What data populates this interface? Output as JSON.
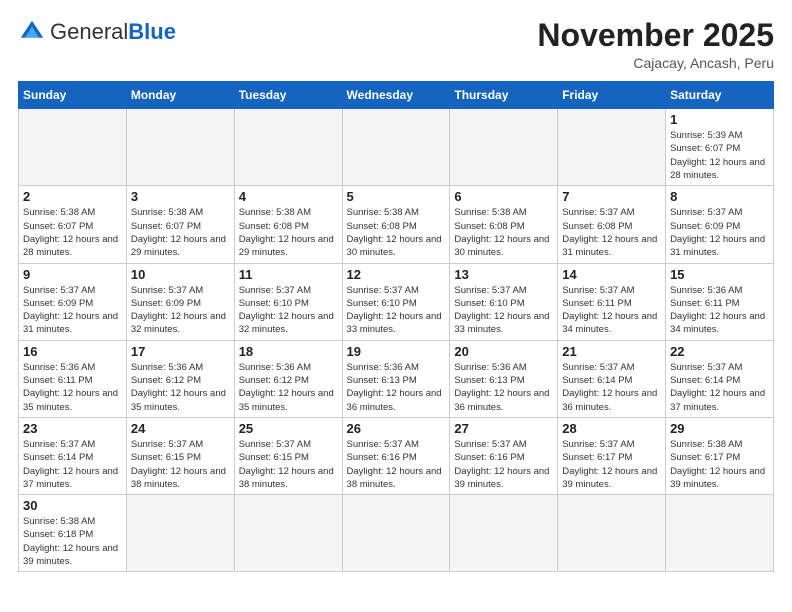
{
  "header": {
    "logo_general": "General",
    "logo_blue": "Blue",
    "month_year": "November 2025",
    "location": "Cajacay, Ancash, Peru"
  },
  "days_of_week": [
    "Sunday",
    "Monday",
    "Tuesday",
    "Wednesday",
    "Thursday",
    "Friday",
    "Saturday"
  ],
  "weeks": [
    [
      {
        "day": "",
        "info": ""
      },
      {
        "day": "",
        "info": ""
      },
      {
        "day": "",
        "info": ""
      },
      {
        "day": "",
        "info": ""
      },
      {
        "day": "",
        "info": ""
      },
      {
        "day": "",
        "info": ""
      },
      {
        "day": "1",
        "info": "Sunrise: 5:39 AM\nSunset: 6:07 PM\nDaylight: 12 hours and 28 minutes."
      }
    ],
    [
      {
        "day": "2",
        "info": "Sunrise: 5:38 AM\nSunset: 6:07 PM\nDaylight: 12 hours and 28 minutes."
      },
      {
        "day": "3",
        "info": "Sunrise: 5:38 AM\nSunset: 6:07 PM\nDaylight: 12 hours and 29 minutes."
      },
      {
        "day": "4",
        "info": "Sunrise: 5:38 AM\nSunset: 6:08 PM\nDaylight: 12 hours and 29 minutes."
      },
      {
        "day": "5",
        "info": "Sunrise: 5:38 AM\nSunset: 6:08 PM\nDaylight: 12 hours and 30 minutes."
      },
      {
        "day": "6",
        "info": "Sunrise: 5:38 AM\nSunset: 6:08 PM\nDaylight: 12 hours and 30 minutes."
      },
      {
        "day": "7",
        "info": "Sunrise: 5:37 AM\nSunset: 6:08 PM\nDaylight: 12 hours and 31 minutes."
      },
      {
        "day": "8",
        "info": "Sunrise: 5:37 AM\nSunset: 6:09 PM\nDaylight: 12 hours and 31 minutes."
      }
    ],
    [
      {
        "day": "9",
        "info": "Sunrise: 5:37 AM\nSunset: 6:09 PM\nDaylight: 12 hours and 31 minutes."
      },
      {
        "day": "10",
        "info": "Sunrise: 5:37 AM\nSunset: 6:09 PM\nDaylight: 12 hours and 32 minutes."
      },
      {
        "day": "11",
        "info": "Sunrise: 5:37 AM\nSunset: 6:10 PM\nDaylight: 12 hours and 32 minutes."
      },
      {
        "day": "12",
        "info": "Sunrise: 5:37 AM\nSunset: 6:10 PM\nDaylight: 12 hours and 33 minutes."
      },
      {
        "day": "13",
        "info": "Sunrise: 5:37 AM\nSunset: 6:10 PM\nDaylight: 12 hours and 33 minutes."
      },
      {
        "day": "14",
        "info": "Sunrise: 5:37 AM\nSunset: 6:11 PM\nDaylight: 12 hours and 34 minutes."
      },
      {
        "day": "15",
        "info": "Sunrise: 5:36 AM\nSunset: 6:11 PM\nDaylight: 12 hours and 34 minutes."
      }
    ],
    [
      {
        "day": "16",
        "info": "Sunrise: 5:36 AM\nSunset: 6:11 PM\nDaylight: 12 hours and 35 minutes."
      },
      {
        "day": "17",
        "info": "Sunrise: 5:36 AM\nSunset: 6:12 PM\nDaylight: 12 hours and 35 minutes."
      },
      {
        "day": "18",
        "info": "Sunrise: 5:36 AM\nSunset: 6:12 PM\nDaylight: 12 hours and 35 minutes."
      },
      {
        "day": "19",
        "info": "Sunrise: 5:36 AM\nSunset: 6:13 PM\nDaylight: 12 hours and 36 minutes."
      },
      {
        "day": "20",
        "info": "Sunrise: 5:36 AM\nSunset: 6:13 PM\nDaylight: 12 hours and 36 minutes."
      },
      {
        "day": "21",
        "info": "Sunrise: 5:37 AM\nSunset: 6:14 PM\nDaylight: 12 hours and 36 minutes."
      },
      {
        "day": "22",
        "info": "Sunrise: 5:37 AM\nSunset: 6:14 PM\nDaylight: 12 hours and 37 minutes."
      }
    ],
    [
      {
        "day": "23",
        "info": "Sunrise: 5:37 AM\nSunset: 6:14 PM\nDaylight: 12 hours and 37 minutes."
      },
      {
        "day": "24",
        "info": "Sunrise: 5:37 AM\nSunset: 6:15 PM\nDaylight: 12 hours and 38 minutes."
      },
      {
        "day": "25",
        "info": "Sunrise: 5:37 AM\nSunset: 6:15 PM\nDaylight: 12 hours and 38 minutes."
      },
      {
        "day": "26",
        "info": "Sunrise: 5:37 AM\nSunset: 6:16 PM\nDaylight: 12 hours and 38 minutes."
      },
      {
        "day": "27",
        "info": "Sunrise: 5:37 AM\nSunset: 6:16 PM\nDaylight: 12 hours and 39 minutes."
      },
      {
        "day": "28",
        "info": "Sunrise: 5:37 AM\nSunset: 6:17 PM\nDaylight: 12 hours and 39 minutes."
      },
      {
        "day": "29",
        "info": "Sunrise: 5:38 AM\nSunset: 6:17 PM\nDaylight: 12 hours and 39 minutes."
      }
    ],
    [
      {
        "day": "30",
        "info": "Sunrise: 5:38 AM\nSunset: 6:18 PM\nDaylight: 12 hours and 39 minutes."
      },
      {
        "day": "",
        "info": ""
      },
      {
        "day": "",
        "info": ""
      },
      {
        "day": "",
        "info": ""
      },
      {
        "day": "",
        "info": ""
      },
      {
        "day": "",
        "info": ""
      },
      {
        "day": "",
        "info": ""
      }
    ]
  ]
}
